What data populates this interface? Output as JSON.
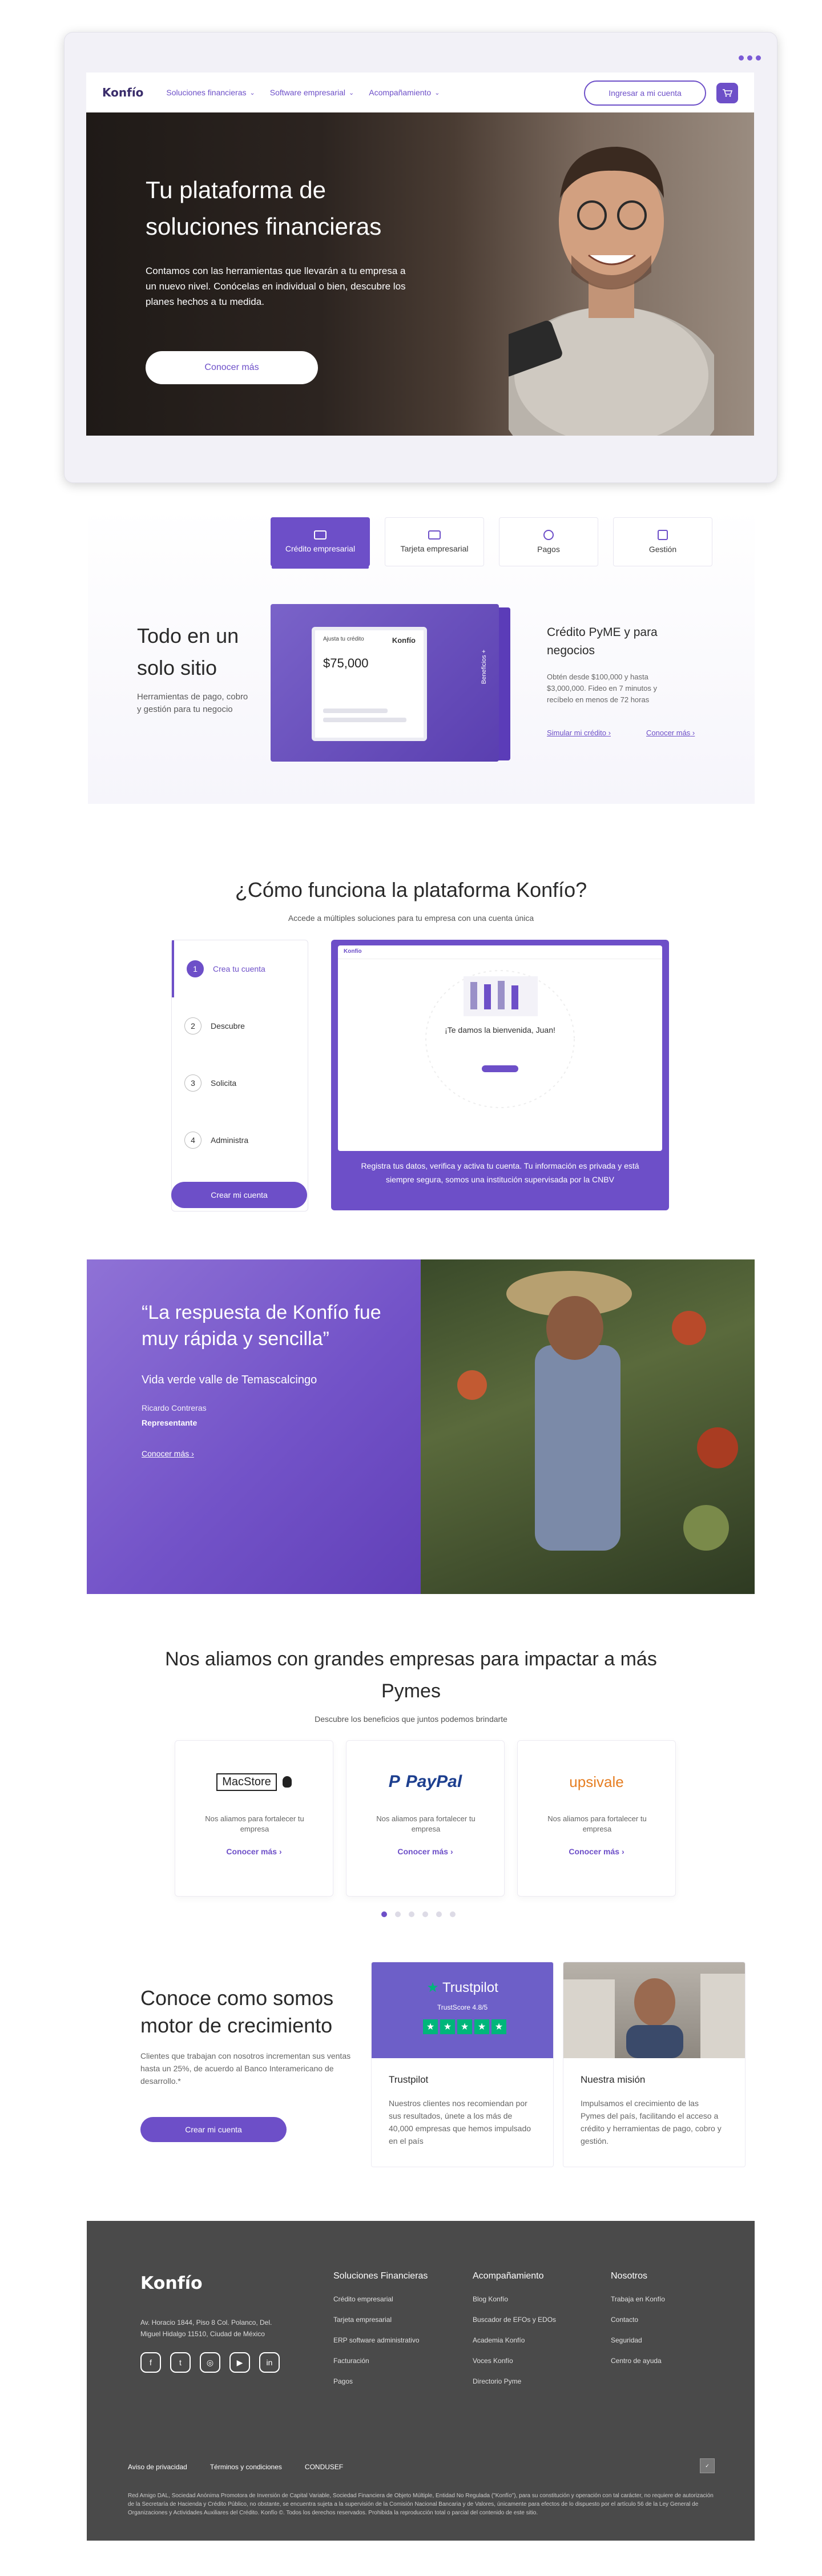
{
  "nav": {
    "logo": "Konfío",
    "items": [
      "Soluciones financieras",
      "Software empresarial",
      "Acompañamiento"
    ],
    "login": "Ingresar a mi cuenta"
  },
  "hero": {
    "title": "Tu plataforma de soluciones financieras",
    "desc": "Contamos con las herramientas que llevarán a tu empresa a un nuevo nivel. Conócelas en individual o bien, descubre los planes hechos a tu medida.",
    "cta": "Conocer más"
  },
  "products": {
    "tabs": [
      "Crédito empresarial",
      "Tarjeta empresarial",
      "Pagos",
      "Gestión"
    ],
    "title": "Todo en un solo sitio",
    "subtitle": "Herramientas de pago, cobro y gestión para tu negocio",
    "card_label": "Ajusta tu crédito",
    "card_brand": "Konfío",
    "card_amount": "$75,000",
    "card_side": "Beneficios +",
    "credit_title": "Crédito PyME y para negocios",
    "credit_desc": "Obtén desde $100,000 y hasta $3,000,000. Fideo en 7 minutos y recíbelo en menos de 72 horas",
    "link_simulate": "Simular mi crédito",
    "link_more": "Conocer más"
  },
  "how": {
    "title": "¿Cómo funciona la plataforma Konfío?",
    "subtitle": "Accede a múltiples soluciones para tu empresa con una cuenta única",
    "steps": [
      {
        "num": "1",
        "label": "Crea tu cuenta"
      },
      {
        "num": "2",
        "label": "Descubre"
      },
      {
        "num": "3",
        "label": "Solicita"
      },
      {
        "num": "4",
        "label": "Administra"
      }
    ],
    "button": "Crear mi cuenta",
    "demo_welcome": "¡Te damos la bienvenida, Juan!",
    "caption": "Registra tus datos, verifica y activa tu cuenta. Tu información es privada y está siempre segura, somos una institución supervisada por la CNBV"
  },
  "testimonial": {
    "quote": "“La respuesta de Konfío fue muy rápida y sencilla”",
    "company": "Vida verde valle de Temascalcingo",
    "name": "Ricardo Contreras",
    "role": "Representante",
    "link": "Conocer más"
  },
  "partners": {
    "title": "Nos aliamos con grandes empresas para impactar a más Pymes",
    "subtitle": "Descubre los beneficios que juntos podemos brindarte",
    "cards": [
      {
        "logo": "MacStore",
        "text": "Nos aliamos para fortalecer tu empresa",
        "more": "Conocer más"
      },
      {
        "logo": "PayPal",
        "text": "Nos aliamos para fortalecer tu empresa",
        "more": "Conocer más"
      },
      {
        "logo": "upsivale",
        "text": "Nos aliamos para fortalecer tu empresa",
        "more": "Conocer más"
      }
    ]
  },
  "growth": {
    "title": "Conoce como somos motor de crecimiento",
    "desc": "Clientes que trabajan con nosotros incrementan sus ventas hasta un 25%, de acuerdo al Banco Interamericano de desarrollo.*",
    "button": "Crear mi cuenta",
    "cards": [
      {
        "title": "Trustpilot",
        "text": "Nuestros clientes nos recomiendan por sus resultados, únete a los más de 40,000 empresas que hemos impulsado en el país",
        "badge": "Trustpilot",
        "score": "TrustScore 4.8/5"
      },
      {
        "title": "Nuestra misión",
        "text": "Impulsamos el crecimiento de las Pymes del país, facilitando el acceso a crédito y herramientas de pago, cobro y gestión."
      }
    ]
  },
  "footer": {
    "logo": "Konfío",
    "address": "Av. Horacio 1844, Piso 8 Col. Polanco, Del. Miguel Hidalgo 11510, Ciudad de México",
    "cols": [
      {
        "head": "Soluciones Financieras",
        "links": [
          "Crédito empresarial",
          "Tarjeta empresarial",
          "ERP software administrativo",
          "Facturación",
          "Pagos"
        ]
      },
      {
        "head": "Acompañamiento",
        "links": [
          "Blog Konfío",
          "Buscador de EFOs y EDOs",
          "Academia Konfío",
          "Voces Konfío",
          "Directorio Pyme"
        ]
      },
      {
        "head": "Nosotros",
        "links": [
          "Trabaja en Konfío",
          "Contacto",
          "Seguridad",
          "Centro de ayuda"
        ]
      }
    ],
    "bottom": [
      "Aviso de privacidad",
      "Términos y condiciones",
      "CONDUSEF"
    ],
    "legal": "Red Amigo DAL, Sociedad Anónima Promotora de Inversión de Capital Variable, Sociedad Financiera de Objeto Múltiple, Entidad No Regulada (\"Konfío\"), para su constitución y operación con tal carácter, no requiere de autorización de la Secretaría de Hacienda y Crédito Público, no obstante, se encuentra sujeta a la supervisión de la Comisión Nacional Bancaria y de Valores, únicamente para efectos de lo dispuesto por el artículo 56 de la Ley General de Organizaciones y Actividades Auxiliares del Crédito. Konfío ©. Todos los derechos reservados. Prohibida la reproducción total o parcial del contenido de este sitio."
  }
}
